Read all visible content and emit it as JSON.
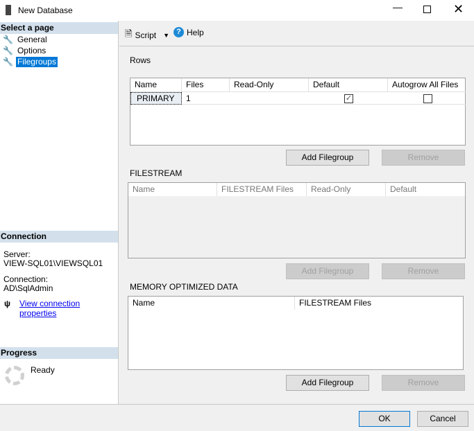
{
  "window": {
    "title": "New Database"
  },
  "left": {
    "select_page": "Select a page",
    "pages": [
      "General",
      "Options",
      "Filegroups"
    ],
    "connection_header": "Connection",
    "server_label": "Server:",
    "server_value": "VIEW-SQL01\\VIEWSQL01",
    "connection_label": "Connection:",
    "connection_value": "AD\\SqlAdmin",
    "view_props": "View connection properties",
    "progress_header": "Progress",
    "progress_status": "Ready"
  },
  "toolbar": {
    "script": "Script",
    "help": "Help"
  },
  "rows": {
    "label": "Rows",
    "columns": [
      "Name",
      "Files",
      "Read-Only",
      "Default",
      "Autogrow All Files"
    ],
    "data": [
      {
        "name": "PRIMARY",
        "files": "1",
        "read_only": "",
        "default": true,
        "autogrow": false
      }
    ],
    "add": "Add Filegroup",
    "remove": "Remove"
  },
  "filestream": {
    "label": "FILESTREAM",
    "columns": [
      "Name",
      "FILESTREAM Files",
      "Read-Only",
      "Default"
    ],
    "add": "Add Filegroup",
    "remove": "Remove"
  },
  "memory": {
    "label": "MEMORY OPTIMIZED DATA",
    "columns": [
      "Name",
      "FILESTREAM Files"
    ],
    "add": "Add Filegroup",
    "remove": "Remove"
  },
  "footer": {
    "ok": "OK",
    "cancel": "Cancel"
  }
}
